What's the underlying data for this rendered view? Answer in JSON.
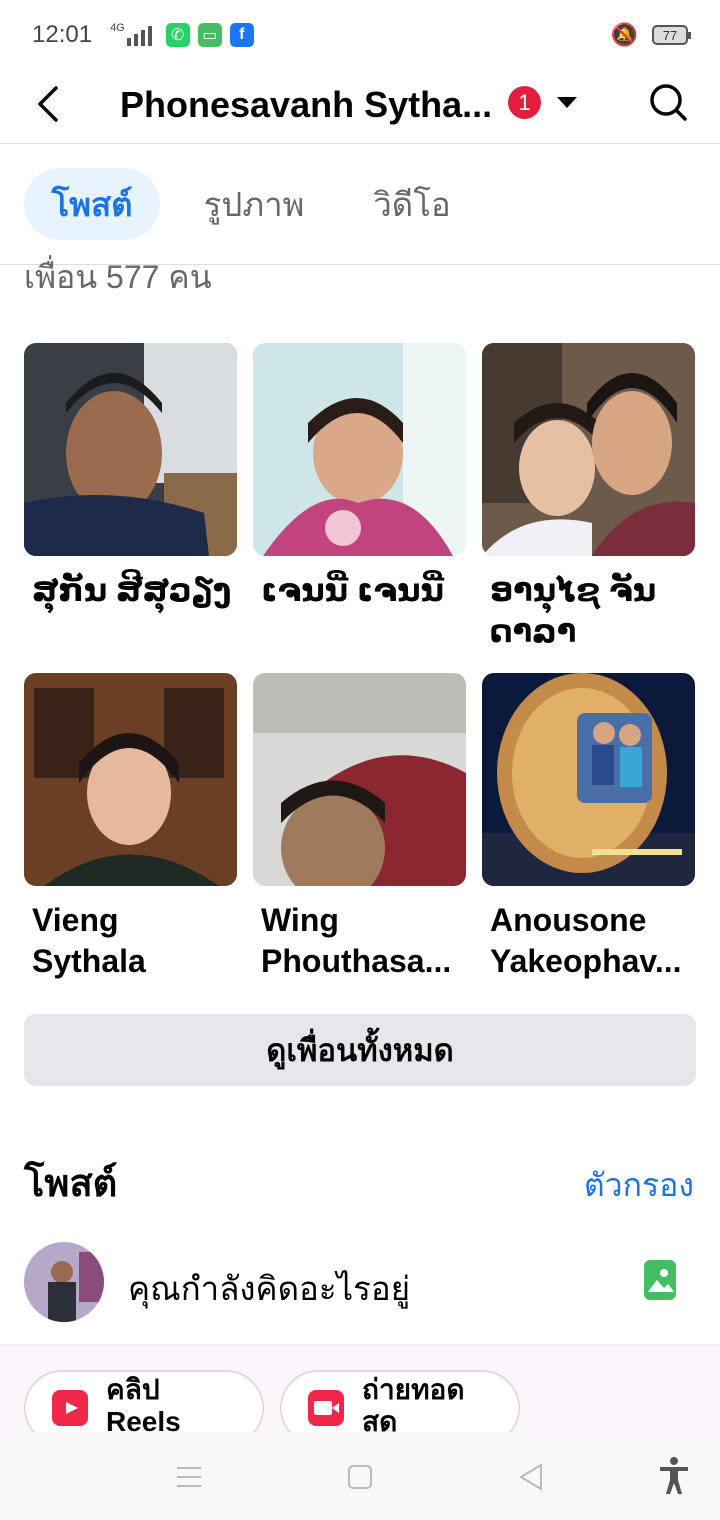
{
  "status_bar": {
    "time": "12:01",
    "network": "4G",
    "battery": "77"
  },
  "header": {
    "title": "Phonesavanh Sytha...",
    "notification_count": "1"
  },
  "tabs": [
    {
      "label": "โพสต์",
      "active": true
    },
    {
      "label": "รูปภาพ",
      "active": false
    },
    {
      "label": "วิดีโอ",
      "active": false
    }
  ],
  "friends": {
    "count_text": "เพื่อน 577 คน",
    "items": [
      {
        "name": "ສຸກັນ ສີສຸວຽງ"
      },
      {
        "name": "ເຈນນີ່ ເຈນນີ່"
      },
      {
        "name": "ອານຸໄຊ ຈັນ ດາລາ"
      },
      {
        "name": "Vieng Sythala"
      },
      {
        "name": "Wing Phouthasa..."
      },
      {
        "name": "Anousone Yakeophav..."
      }
    ],
    "see_all_label": "ดูเพื่อนทั้งหมด"
  },
  "posts": {
    "heading": "โพสต์",
    "filter_label": "ตัวกรอง",
    "composer_placeholder": "คุณกำลังคิดอะไรอยู่",
    "chips": [
      {
        "label_line1": "คลิป",
        "label_line2": "Reels"
      },
      {
        "label_line1": "ถ่ายทอด",
        "label_line2": "สด"
      }
    ]
  },
  "colors": {
    "accent": "#1b74e4",
    "badge": "#e41e3f",
    "photo_icon": "#45bd62"
  }
}
